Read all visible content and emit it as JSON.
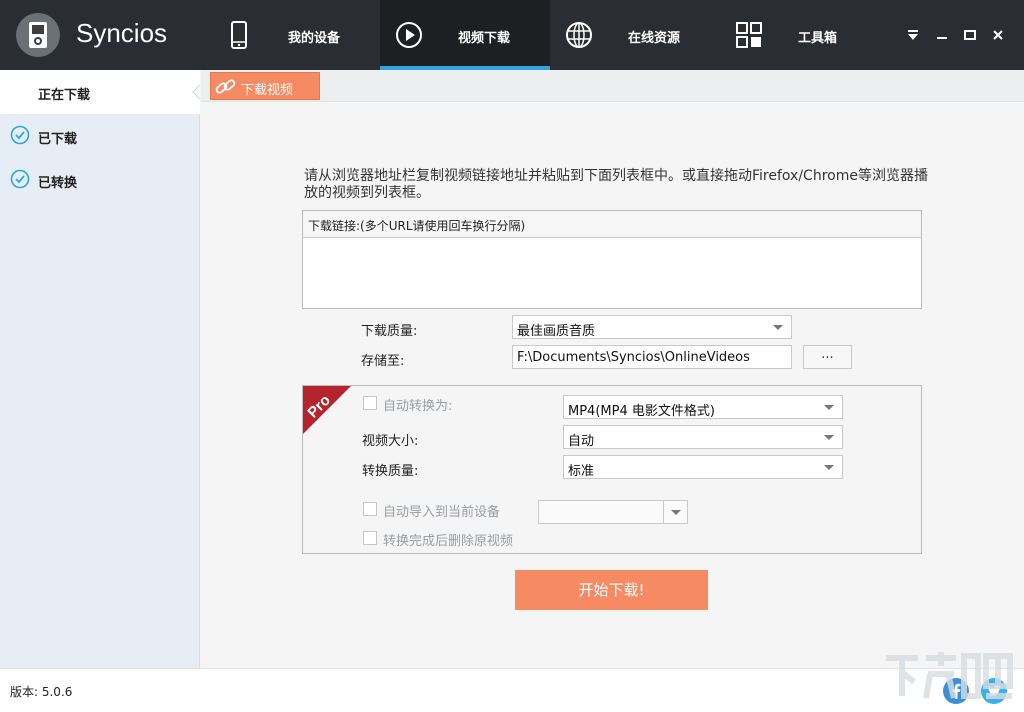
{
  "app": {
    "title": "Syncios"
  },
  "nav": {
    "tabs": [
      {
        "label": "我的设备",
        "icon": "phone-icon"
      },
      {
        "label": "视频下载",
        "icon": "play-circle-icon",
        "active": true
      },
      {
        "label": "在线资源",
        "icon": "globe-icon"
      },
      {
        "label": "工具箱",
        "icon": "grid-icon"
      }
    ]
  },
  "window_controls": {
    "icons": [
      "dropdown-menu-icon",
      "minimize-icon",
      "maximize-icon",
      "close-icon"
    ]
  },
  "sidebar": {
    "items": [
      {
        "label": "正在下载",
        "active": true
      },
      {
        "label": "已下载",
        "icon": "check-circle-icon"
      },
      {
        "label": "已转换",
        "icon": "check-circle-icon"
      }
    ]
  },
  "main": {
    "tab_label": "下载视频",
    "instruction": "请从浏览器地址栏复制视频链接地址并粘贴到下面列表框中。或直接拖动Firefox/Chrome等浏览器播放的视频到列表框。",
    "url_header": "下载链接:(多个URL请使用回车换行分隔)",
    "url_value": "",
    "quality_label": "下载质量:",
    "quality_value": "最佳画质音质",
    "save_label": "存储至:",
    "save_path": "F:\\Documents\\Syncios\\OnlineVideos",
    "browse_label": "...",
    "pro": {
      "badge": "Pro",
      "auto_convert_label": "自动转换为:",
      "auto_convert_value": "MP4(MP4 电影文件格式)",
      "video_size_label": "视频大小:",
      "video_size_value": "自动",
      "convert_quality_label": "转换质量:",
      "convert_quality_value": "标准",
      "auto_import_label": "自动导入到当前设备",
      "auto_import_value": "",
      "delete_original_label": "转换完成后删除原视频"
    },
    "start_button": "开始下载!"
  },
  "footer": {
    "version": "版本: 5.0.6"
  },
  "colors": {
    "accent": "#f58a63",
    "topbar": "#2a2d31",
    "active_underline": "#2ea5dd",
    "sidebar": "#e6edf4"
  }
}
